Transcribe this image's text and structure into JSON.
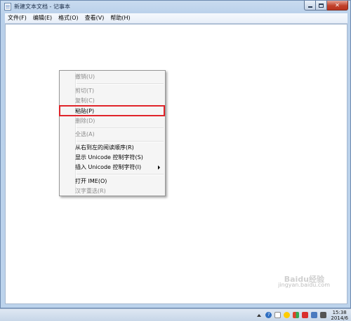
{
  "window": {
    "title": "新建文本文档 - 记事本"
  },
  "menubar": {
    "items": [
      "文件(F)",
      "编辑(E)",
      "格式(O)",
      "查看(V)",
      "帮助(H)"
    ]
  },
  "context_menu": {
    "items": [
      {
        "label": "撤销(U)",
        "enabled": false
      },
      {
        "label": "剪切(T)",
        "enabled": false
      },
      {
        "label": "复制(C)",
        "enabled": false
      },
      {
        "label": "粘贴(P)",
        "enabled": true,
        "highlighted": true
      },
      {
        "label": "删除(D)",
        "enabled": false
      },
      {
        "label": "全选(A)",
        "enabled": false
      },
      {
        "label": "从右到左的阅读顺序(R)",
        "enabled": true
      },
      {
        "label": "显示 Unicode 控制字符(S)",
        "enabled": true
      },
      {
        "label": "插入 Unicode 控制字符(I)",
        "enabled": true,
        "submenu": true
      },
      {
        "label": "打开 IME(O)",
        "enabled": true
      },
      {
        "label": "汉字重选(R)",
        "enabled": false
      }
    ]
  },
  "highlight_color": "#e0242a",
  "watermark": {
    "logo": "Baidu经验",
    "url": "jingyan.baidu.com"
  },
  "taskbar": {
    "tray_icons": [
      "show-hidden-icons-arrow",
      "help-icon",
      "ime-icon",
      "qq-icon",
      "flag-icon",
      "security-icon",
      "network-icon",
      "volume-icon"
    ],
    "time": "15:38",
    "date": "2014/6"
  }
}
